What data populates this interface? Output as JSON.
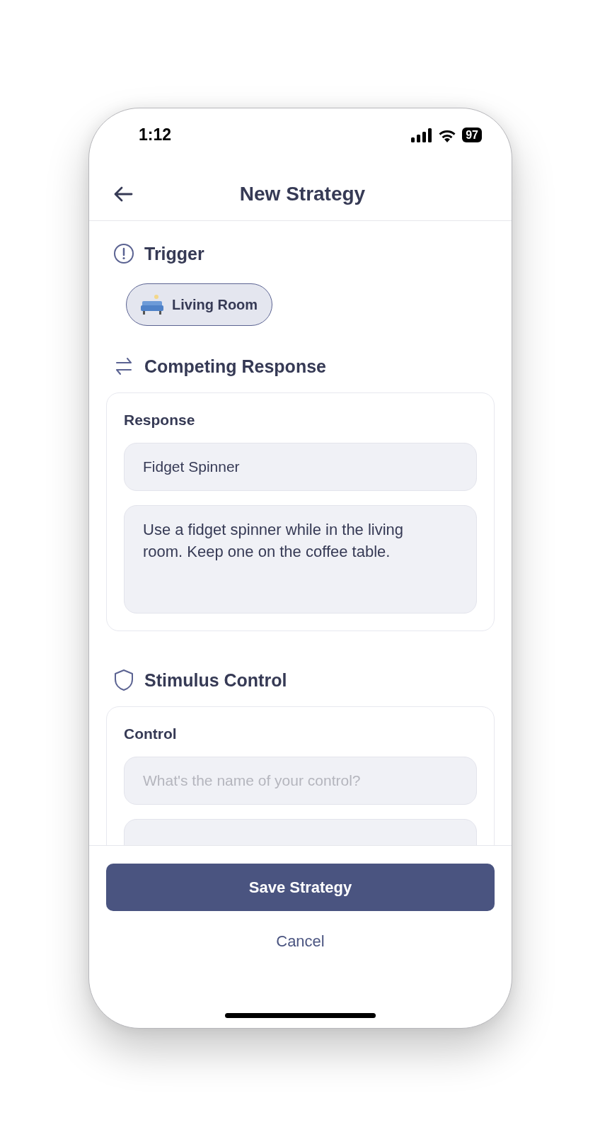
{
  "status_bar": {
    "time": "1:12",
    "battery": "97"
  },
  "header": {
    "title": "New Strategy"
  },
  "sections": [
    {
      "kind": "chips",
      "title": "Trigger",
      "chips": [
        {
          "label": "Living Room",
          "selected": true
        }
      ]
    },
    {
      "kind": "card",
      "title": "Competing Response",
      "card": {
        "label": "Response",
        "fields": [
          {
            "kind": "input",
            "value": "Fidget Spinner"
          },
          {
            "kind": "textarea",
            "value": "Use a fidget spinner while in the living room. Keep one on the coffee table."
          }
        ]
      }
    },
    {
      "kind": "card",
      "title": "Stimulus Control",
      "card": {
        "label": "Control",
        "fields": [
          {
            "kind": "input",
            "placeholder": "What's the name of your control?"
          },
          {
            "kind": "textarea"
          }
        ]
      }
    }
  ],
  "footer": {
    "primary": "Save Strategy",
    "secondary": "Cancel"
  }
}
